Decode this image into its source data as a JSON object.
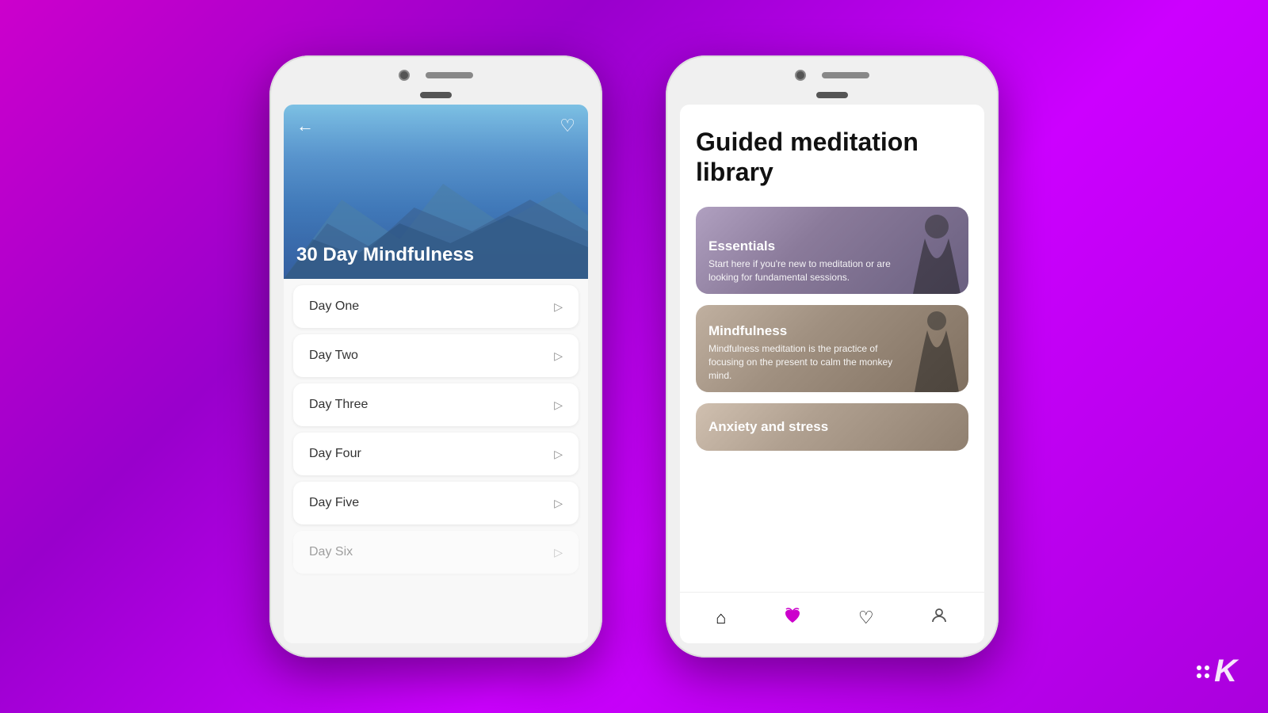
{
  "background": {
    "gradient_start": "#cc00cc",
    "gradient_end": "#9900cc"
  },
  "left_phone": {
    "hero_title": "30 Day Mindfulness",
    "back_label": "←",
    "heart_label": "♡",
    "days": [
      {
        "label": "Day One",
        "dimmed": false
      },
      {
        "label": "Day Two",
        "dimmed": false
      },
      {
        "label": "Day Three",
        "dimmed": false
      },
      {
        "label": "Day Four",
        "dimmed": false
      },
      {
        "label": "Day Five",
        "dimmed": false
      },
      {
        "label": "Day Six",
        "dimmed": true
      }
    ]
  },
  "right_phone": {
    "title": "Guided meditation library",
    "cards": [
      {
        "name": "Essentials",
        "description": "Start here if you're new to meditation or are looking for fundamental sessions."
      },
      {
        "name": "Mindfulness",
        "description": "Mindfulness meditation is the practice of focusing on the present to calm the monkey mind."
      },
      {
        "name": "Anxiety and stress",
        "description": ""
      }
    ],
    "nav": [
      {
        "icon": "⌂",
        "label": "home",
        "active": false
      },
      {
        "icon": "🪷",
        "label": "meditate",
        "active": true
      },
      {
        "icon": "♡",
        "label": "favorites",
        "active": false
      },
      {
        "icon": "👤",
        "label": "profile",
        "active": false
      }
    ]
  },
  "watermark": {
    "letter": "K"
  }
}
